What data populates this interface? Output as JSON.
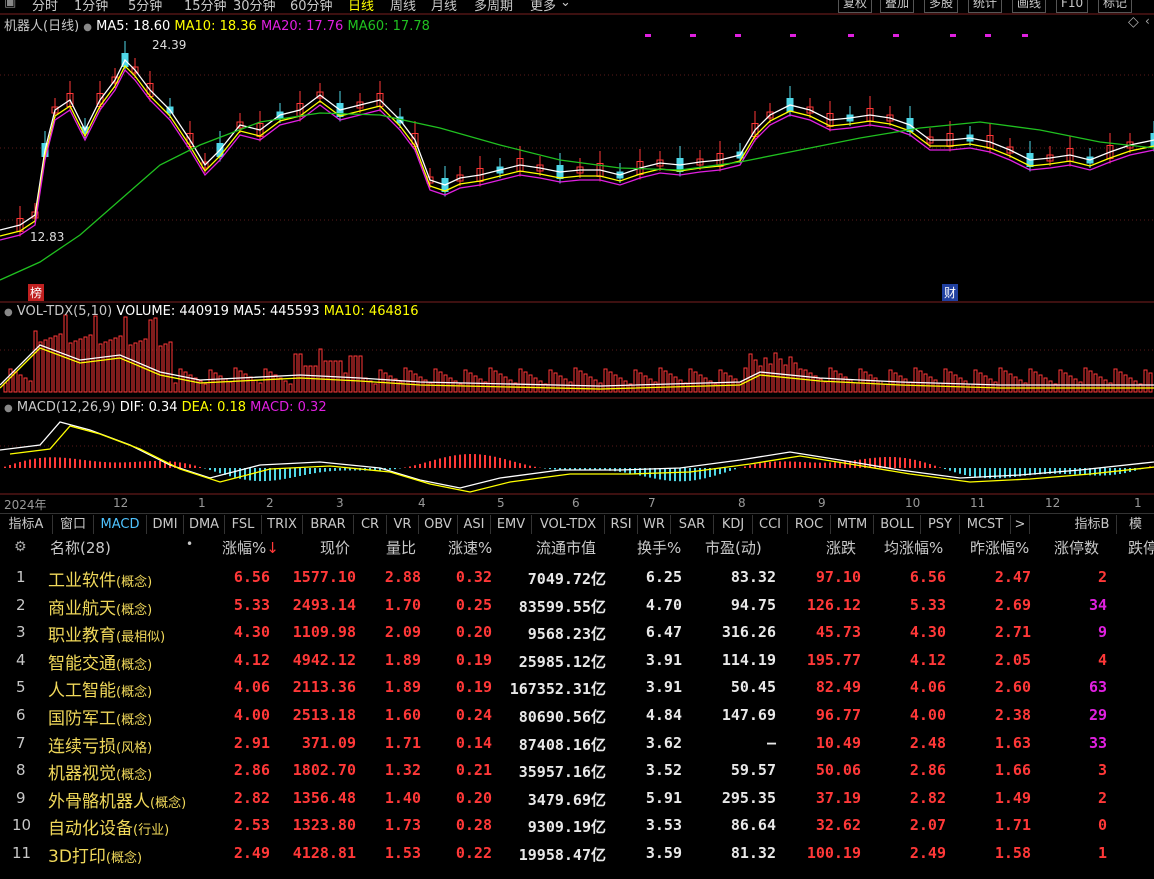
{
  "toolbar": {
    "tabs": [
      "分时",
      "1分钟",
      "5分钟",
      "15分钟",
      "30分钟",
      "60分钟",
      "日线",
      "周线",
      "月线",
      "多周期",
      "更多"
    ],
    "active": "日线",
    "right_buttons": [
      "复权",
      "叠加",
      "多股",
      "统计",
      "画线",
      "F10",
      "标记"
    ]
  },
  "price_panel": {
    "title": "机器人(日线)",
    "ma5": "MA5: 18.60",
    "ma10": "MA10: 18.36",
    "ma20": "MA20: 17.76",
    "ma60": "MA60: 17.78",
    "high_label": "24.39",
    "low_label": "12.83",
    "badge_left": "榜",
    "badge_right": "财"
  },
  "volume_panel": {
    "title": "VOL-TDX(5,10)",
    "volume": "VOLUME: 440919",
    "ma5": "MA5: 445593",
    "ma10": "MA10: 464816"
  },
  "macd_panel": {
    "title": "MACD(12,26,9)",
    "dif": "DIF: 0.34",
    "dea": "DEA: 0.18",
    "macd": "MACD: 0.32"
  },
  "time_axis": [
    "2024年",
    "12",
    "1",
    "2",
    "3",
    "4",
    "5",
    "6",
    "7",
    "8",
    "9",
    "10",
    "11",
    "12",
    "1"
  ],
  "indicator_tabs": [
    "指标A",
    "窗口",
    "MACD",
    "DMI",
    "DMA",
    "FSL",
    "TRIX",
    "BRAR",
    "CR",
    "VR",
    "OBV",
    "ASI",
    "EMV",
    "VOL-TDX",
    "RSI",
    "WR",
    "SAR",
    "KDJ",
    "CCI",
    "ROC",
    "MTM",
    "BOLL",
    "PSY",
    "MCST",
    ">",
    "指标B",
    "模"
  ],
  "active_indicator": "MACD",
  "table": {
    "headers": [
      "名称(28)",
      "•",
      "涨幅%",
      "现价",
      "量比",
      "涨速%",
      "流通市值",
      "换手%",
      "市盈(动)",
      "涨跌",
      "均涨幅%",
      "昨涨幅%",
      "涨停数",
      "跌停"
    ],
    "sort_arrow": "↓",
    "rows": [
      {
        "idx": "1",
        "name": "工业软件",
        "tag": "(概念)",
        "chg": "6.56",
        "price": "1577.10",
        "vr": "2.88",
        "spd": "0.32",
        "mcap": "7049.72亿",
        "turn": "6.25",
        "pe": "83.32",
        "diff": "97.10",
        "avg": "6.56",
        "yest": "2.47",
        "limit": "2",
        "limit_color": "red"
      },
      {
        "idx": "2",
        "name": "商业航天",
        "tag": "(概念)",
        "chg": "5.33",
        "price": "2493.14",
        "vr": "1.70",
        "spd": "0.25",
        "mcap": "83599.55亿",
        "turn": "4.70",
        "pe": "94.75",
        "diff": "126.12",
        "avg": "5.33",
        "yest": "2.69",
        "limit": "34",
        "limit_color": "purple"
      },
      {
        "idx": "3",
        "name": "职业教育",
        "tag": "(最相似)",
        "chg": "4.30",
        "price": "1109.98",
        "vr": "2.09",
        "spd": "0.20",
        "mcap": "9568.23亿",
        "turn": "6.47",
        "pe": "316.26",
        "diff": "45.73",
        "avg": "4.30",
        "yest": "2.71",
        "limit": "9",
        "limit_color": "purple"
      },
      {
        "idx": "4",
        "name": "智能交通",
        "tag": "(概念)",
        "chg": "4.12",
        "price": "4942.12",
        "vr": "1.89",
        "spd": "0.19",
        "mcap": "25985.12亿",
        "turn": "3.91",
        "pe": "114.19",
        "diff": "195.77",
        "avg": "4.12",
        "yest": "2.05",
        "limit": "4",
        "limit_color": "red"
      },
      {
        "idx": "5",
        "name": "人工智能",
        "tag": "(概念)",
        "chg": "4.06",
        "price": "2113.36",
        "vr": "1.89",
        "spd": "0.19",
        "mcap": "167352.31亿",
        "turn": "3.91",
        "pe": "50.45",
        "diff": "82.49",
        "avg": "4.06",
        "yest": "2.60",
        "limit": "63",
        "limit_color": "purple"
      },
      {
        "idx": "6",
        "name": "国防军工",
        "tag": "(概念)",
        "chg": "4.00",
        "price": "2513.18",
        "vr": "1.60",
        "spd": "0.24",
        "mcap": "80690.56亿",
        "turn": "4.84",
        "pe": "147.69",
        "diff": "96.77",
        "avg": "4.00",
        "yest": "2.38",
        "limit": "29",
        "limit_color": "purple"
      },
      {
        "idx": "7",
        "name": "连续亏损",
        "tag": "(风格)",
        "chg": "2.91",
        "price": "371.09",
        "vr": "1.71",
        "spd": "0.14",
        "mcap": "87408.16亿",
        "turn": "3.62",
        "pe": "—",
        "diff": "10.49",
        "avg": "2.48",
        "yest": "1.63",
        "limit": "33",
        "limit_color": "purple"
      },
      {
        "idx": "8",
        "name": "机器视觉",
        "tag": "(概念)",
        "chg": "2.86",
        "price": "1802.70",
        "vr": "1.32",
        "spd": "0.21",
        "mcap": "35957.16亿",
        "turn": "3.52",
        "pe": "59.57",
        "diff": "50.06",
        "avg": "2.86",
        "yest": "1.66",
        "limit": "3",
        "limit_color": "red"
      },
      {
        "idx": "9",
        "name": "外骨骼机器人",
        "tag": "(概念)",
        "chg": "2.82",
        "price": "1356.48",
        "vr": "1.40",
        "spd": "0.20",
        "mcap": "3479.69亿",
        "turn": "5.91",
        "pe": "295.35",
        "diff": "37.19",
        "avg": "2.82",
        "yest": "1.49",
        "limit": "2",
        "limit_color": "red"
      },
      {
        "idx": "10",
        "name": "自动化设备",
        "tag": "(行业)",
        "chg": "2.53",
        "price": "1323.80",
        "vr": "1.73",
        "spd": "0.28",
        "mcap": "9309.19亿",
        "turn": "3.53",
        "pe": "86.64",
        "diff": "32.62",
        "avg": "2.07",
        "yest": "1.71",
        "limit": "0",
        "limit_color": "red"
      },
      {
        "idx": "11",
        "name": "3D打印",
        "tag": "(概念)",
        "chg": "2.49",
        "price": "4128.81",
        "vr": "1.53",
        "spd": "0.22",
        "mcap": "19958.47亿",
        "turn": "3.59",
        "pe": "81.32",
        "diff": "100.19",
        "avg": "2.49",
        "yest": "1.58",
        "limit": "1",
        "limit_color": "red"
      }
    ]
  },
  "colors": {
    "up": "#ff3838",
    "down": "#4fd8e8",
    "ma5": "#ffffff",
    "ma10": "#ffff00",
    "ma20": "#e020e0",
    "ma60": "#20c020",
    "name": "#f0d85a"
  }
}
